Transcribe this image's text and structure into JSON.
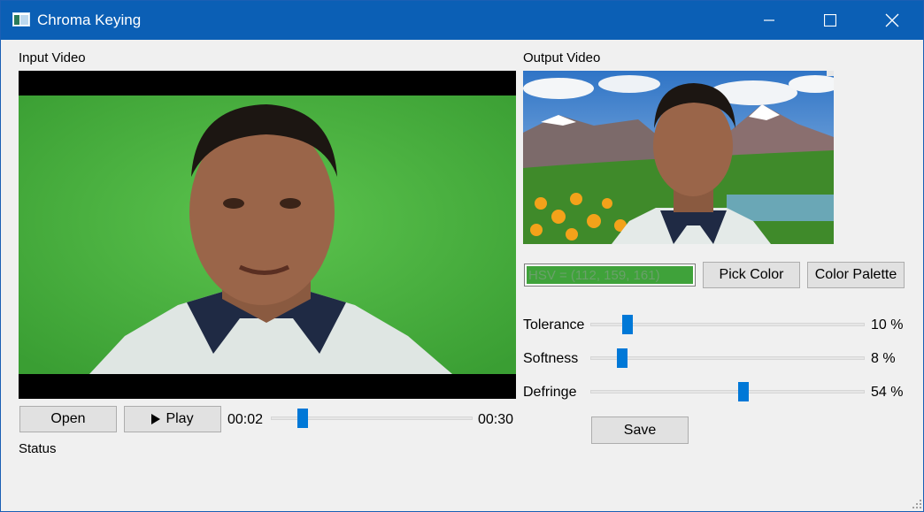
{
  "window": {
    "title": "Chroma Keying"
  },
  "input": {
    "label": "Input Video"
  },
  "output": {
    "label": "Output Video"
  },
  "player": {
    "open_label": "Open",
    "play_label": "Play",
    "current_time": "00:02",
    "total_time": "00:30",
    "progress": 0.067
  },
  "status": {
    "text": "Status"
  },
  "color": {
    "hsv_text": "HSV = (112, 159, 161)",
    "swatch_hex": "#3fa23a",
    "pick_label": "Pick Color",
    "palette_label": "Color Palette"
  },
  "sliders": [
    {
      "label": "Tolerance",
      "value_text": "10 %",
      "value": 10
    },
    {
      "label": "Softness",
      "value_text": "8 %",
      "value": 8
    },
    {
      "label": "Defringe",
      "value_text": "54 %",
      "value": 54
    }
  ],
  "save_label": "Save",
  "colors": {
    "titlebar": "#0b5fb5",
    "slider_thumb": "#0078d7",
    "green_screen": "#4db840"
  }
}
